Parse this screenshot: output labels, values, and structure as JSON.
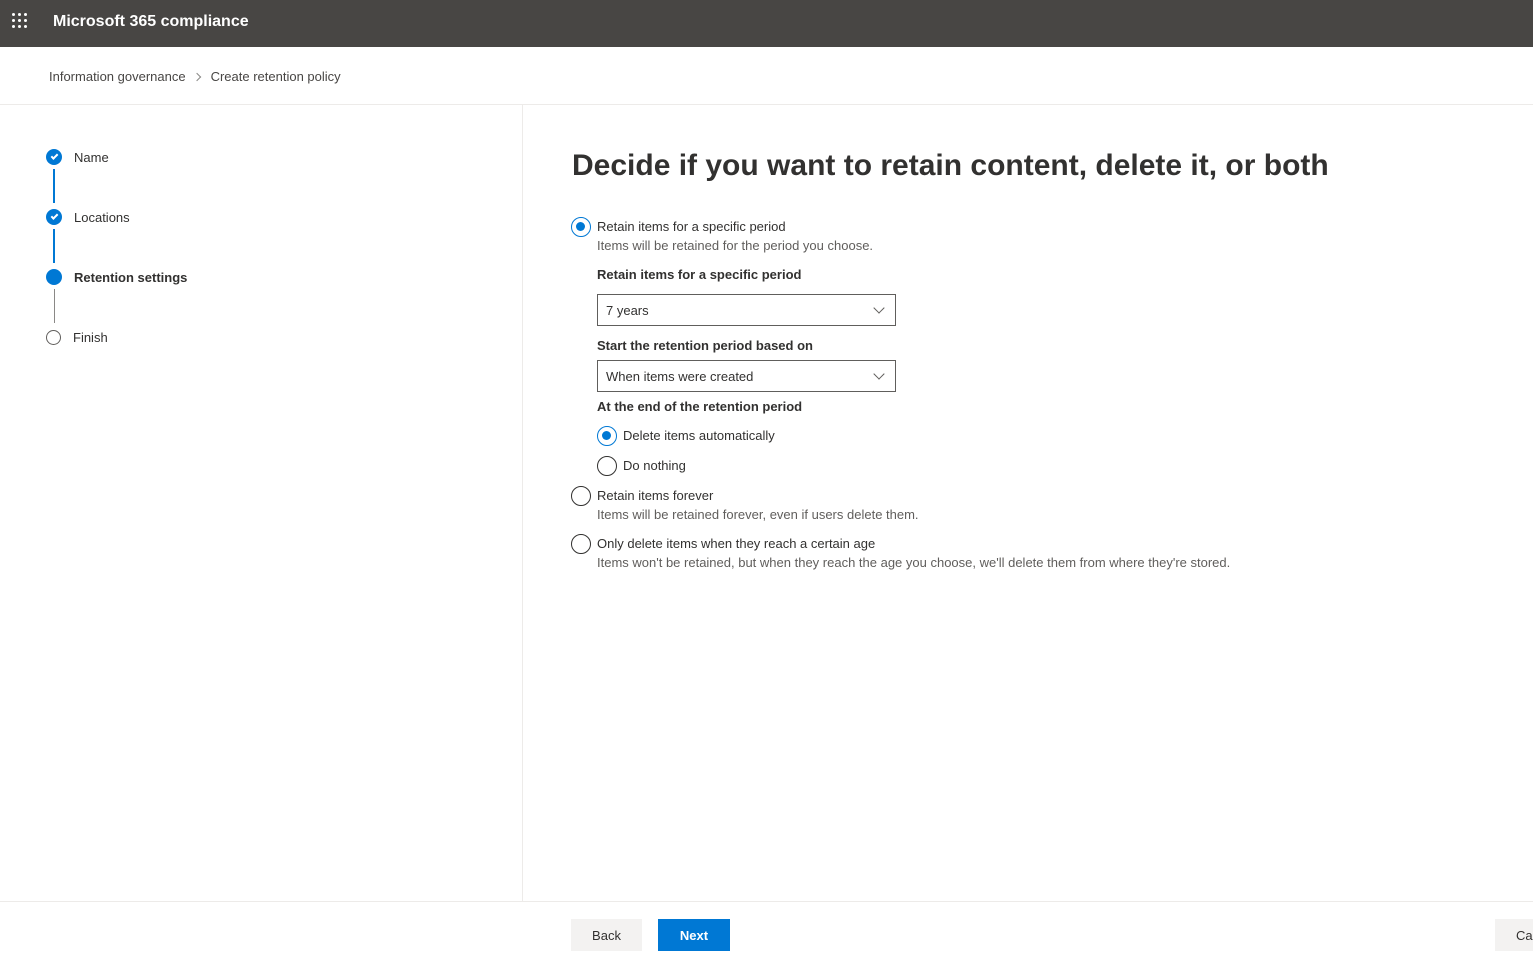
{
  "header": {
    "app_title": "Microsoft 365 compliance",
    "waffle_icon": "waffle-icon"
  },
  "breadcrumb": {
    "items": [
      "Information governance",
      "Create retention policy"
    ]
  },
  "steps": [
    {
      "label": "Name",
      "state": "completed"
    },
    {
      "label": "Locations",
      "state": "completed"
    },
    {
      "label": "Retention settings",
      "state": "current"
    },
    {
      "label": "Finish",
      "state": "not-started"
    }
  ],
  "main": {
    "title": "Decide if you want to retain content, delete it, or both",
    "options": {
      "retain_period": {
        "label": "Retain items for a specific period",
        "description": "Items will be retained for the period you choose.",
        "selected": true
      },
      "retain_forever": {
        "label": "Retain items forever",
        "description": "Items will be retained forever, even if users delete them.",
        "selected": false
      },
      "delete_only": {
        "label": "Only delete items when they reach a certain age",
        "description": "Items won't be retained, but when they reach the age you choose, we'll delete them from where they're stored.",
        "selected": false
      }
    },
    "period_field": {
      "label": "Retain items for a specific period",
      "value": "7 years"
    },
    "start_field": {
      "label": "Start the retention period based on",
      "value": "When items were created"
    },
    "end_section": {
      "label": "At the end of the retention period",
      "options": [
        {
          "label": "Delete items automatically",
          "selected": true
        },
        {
          "label": "Do nothing",
          "selected": false
        }
      ]
    }
  },
  "footer": {
    "back_label": "Back",
    "next_label": "Next",
    "cancel_label": "Ca"
  },
  "colors": {
    "accent": "#0078d4",
    "topbar": "#484644"
  }
}
